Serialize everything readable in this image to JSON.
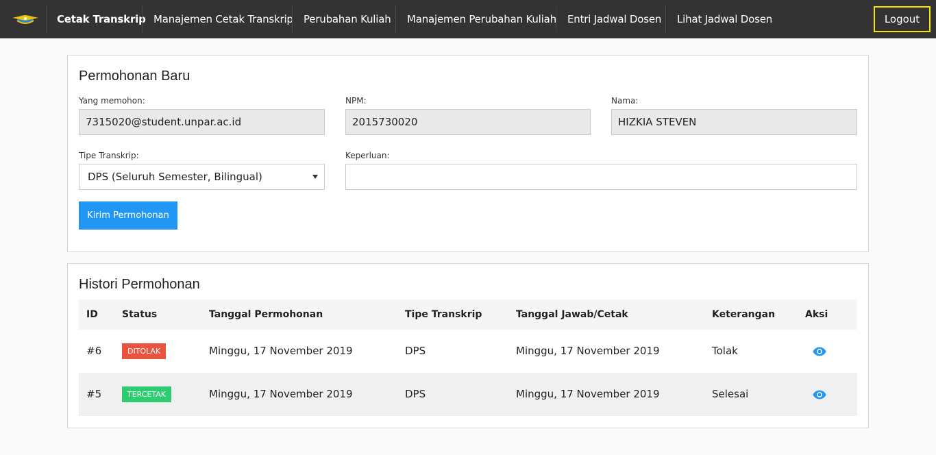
{
  "nav": {
    "items": [
      {
        "label": "Cetak Transkrip"
      },
      {
        "label": "Manajemen Cetak Transkrip"
      },
      {
        "label": "Perubahan Kuliah"
      },
      {
        "label": "Manajemen Perubahan Kuliah"
      },
      {
        "label": "Entri Jadwal Dosen"
      },
      {
        "label": "Lihat Jadwal Dosen"
      }
    ],
    "logout_label": "Logout",
    "logo_icon": "unpar-logo-icon",
    "highlight_color": "#f2e600"
  },
  "new_request": {
    "title": "Permohonan Baru",
    "requester_label": "Yang memohon:",
    "requester_value": "7315020@student.unpar.ac.id",
    "npm_label": "NPM:",
    "npm_value": "2015730020",
    "name_label": "Nama:",
    "name_value": "HIZKIA STEVEN",
    "type_label": "Tipe Transkrip:",
    "type_value": "DPS (Seluruh Semester, Bilingual)",
    "purpose_label": "Keperluan:",
    "purpose_value": "",
    "submit_label": "Kirim Permohonan",
    "accent_color": "#2196f3"
  },
  "history": {
    "title": "Histori Permohonan",
    "columns": [
      "ID",
      "Status",
      "Tanggal Permohonan",
      "Tipe Transkrip",
      "Tanggal Jawab/Cetak",
      "Keterangan",
      "Aksi"
    ],
    "rows": [
      {
        "id": "#6",
        "status": "Ditolak",
        "request_date": "Minggu, 17 November 2019",
        "type": "DPS",
        "answer_date": "Minggu, 17 November 2019",
        "note": "Tolak",
        "action_icon": "eye-icon"
      },
      {
        "id": "#5",
        "status": "Tercetak",
        "request_date": "Minggu, 17 November 2019",
        "type": "DPS",
        "answer_date": "Minggu, 17 November 2019",
        "note": "Selesai",
        "action_icon": "eye-icon"
      }
    ],
    "status_colors": {
      "Ditolak": "#e8543f",
      "Tercetak": "#2ecc71"
    }
  }
}
